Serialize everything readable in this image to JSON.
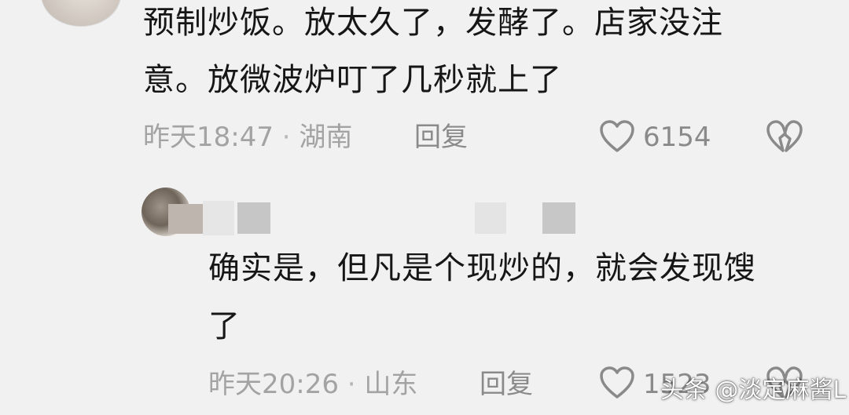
{
  "comments": [
    {
      "text_lines": [
        "预制炒饭。放太久了，发酵了。店家没注",
        "意。放微波炉叮了几秒就上了"
      ],
      "time": "昨天18:47",
      "separator": "·",
      "location": "湖南",
      "reply_label": "回复",
      "like_count": "6154"
    },
    {
      "text_lines": [
        "确实是，但凡是个现炒的，就会发现馊",
        "了"
      ],
      "time": "昨天20:26",
      "separator": "·",
      "location": "山东",
      "reply_label": "回复",
      "like_count": "1523"
    }
  ],
  "watermark": "头条 @淡定麻酱L",
  "icons": {
    "like": "heart-outline-icon",
    "dislike": "broken-heart-icon"
  },
  "colors": {
    "background": "#f1f1f1",
    "text": "#161616",
    "meta": "#a3a3a3",
    "action": "#8a8a8a"
  }
}
